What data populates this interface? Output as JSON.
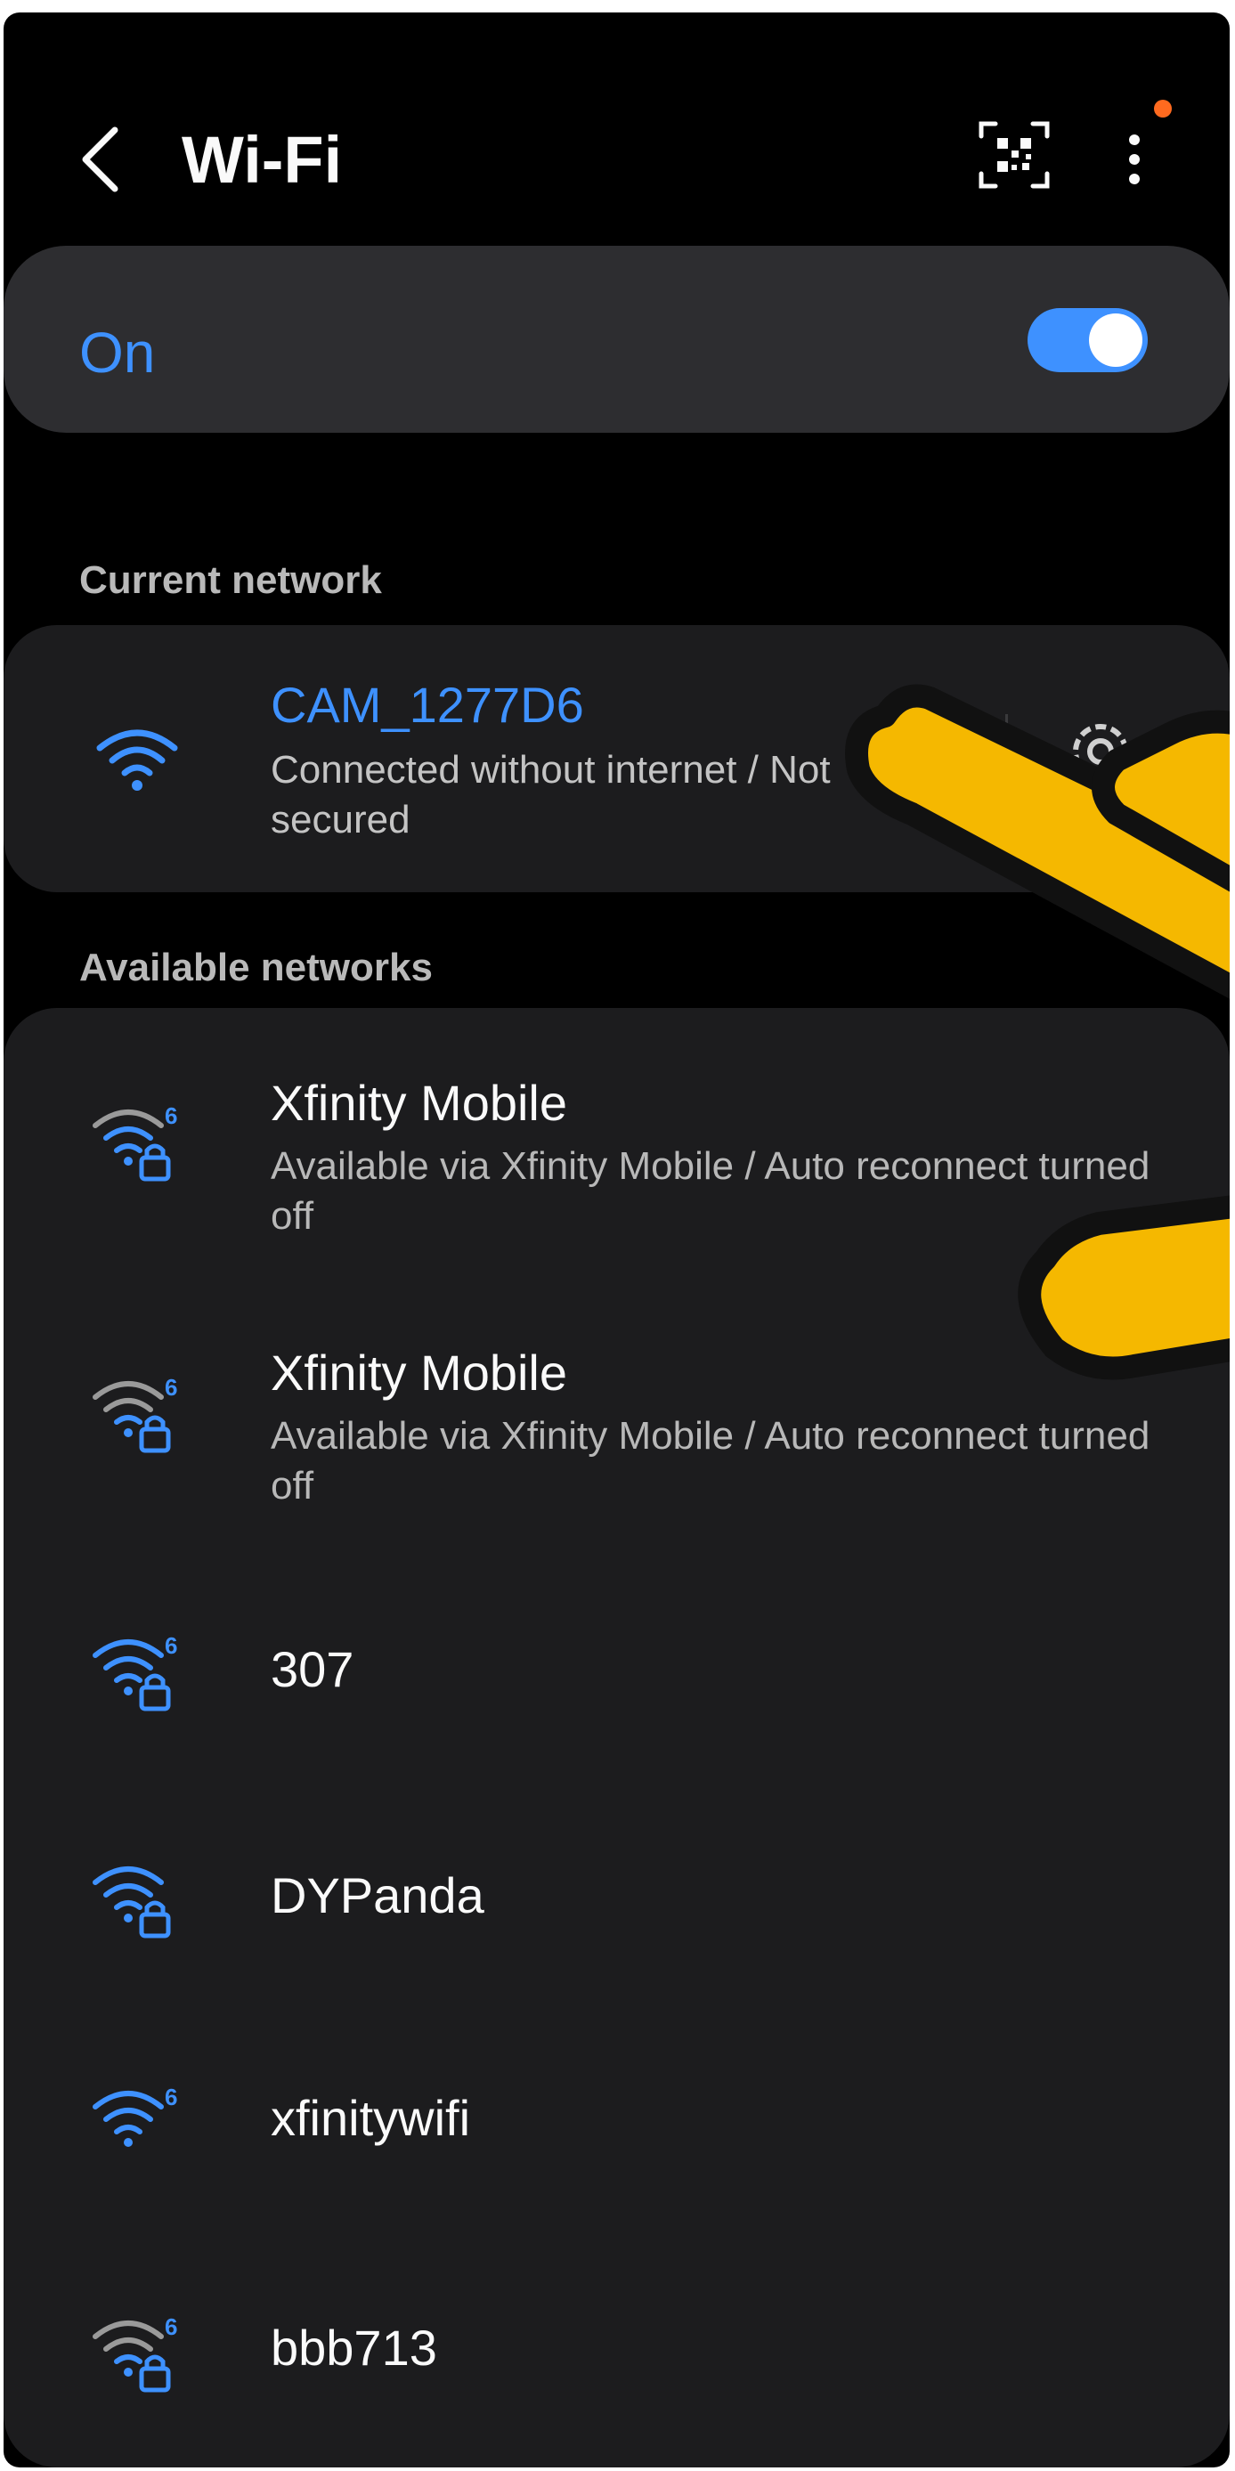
{
  "header": {
    "title": "Wi-Fi"
  },
  "wifi_toggle": {
    "label": "On",
    "enabled": true
  },
  "current_network": {
    "section_label": "Current network",
    "name": "CAM_1277D6",
    "status": "Connected without internet / Not secured"
  },
  "available_networks": {
    "section_label": "Available networks",
    "items": [
      {
        "name": "Xfinity Mobile",
        "subtitle": "Available via Xfinity Mobile / Auto reconnect turned off",
        "wifi6": true,
        "locked": true
      },
      {
        "name": "Xfinity Mobile",
        "subtitle": "Available via Xfinity Mobile / Auto reconnect turned off",
        "wifi6": true,
        "locked": true
      },
      {
        "name": "307",
        "subtitle": "",
        "wifi6": true,
        "locked": true
      },
      {
        "name": "DYPanda",
        "subtitle": "",
        "wifi6": false,
        "locked": true
      },
      {
        "name": "xfinitywifi",
        "subtitle": "",
        "wifi6": true,
        "locked": false
      },
      {
        "name": "bbb713",
        "subtitle": "",
        "wifi6": true,
        "locked": true
      }
    ]
  },
  "colors": {
    "accent": "#3e91ff",
    "background": "#000000",
    "card": "#1c1c1e",
    "notification_dot": "#ff6a1f",
    "hand_fill": "#f5b800"
  },
  "icons": [
    "back-arrow-icon",
    "qr-code-icon",
    "more-options-icon",
    "wifi-icon",
    "wifi6-lock-icon",
    "info-icon",
    "gear-icon"
  ]
}
